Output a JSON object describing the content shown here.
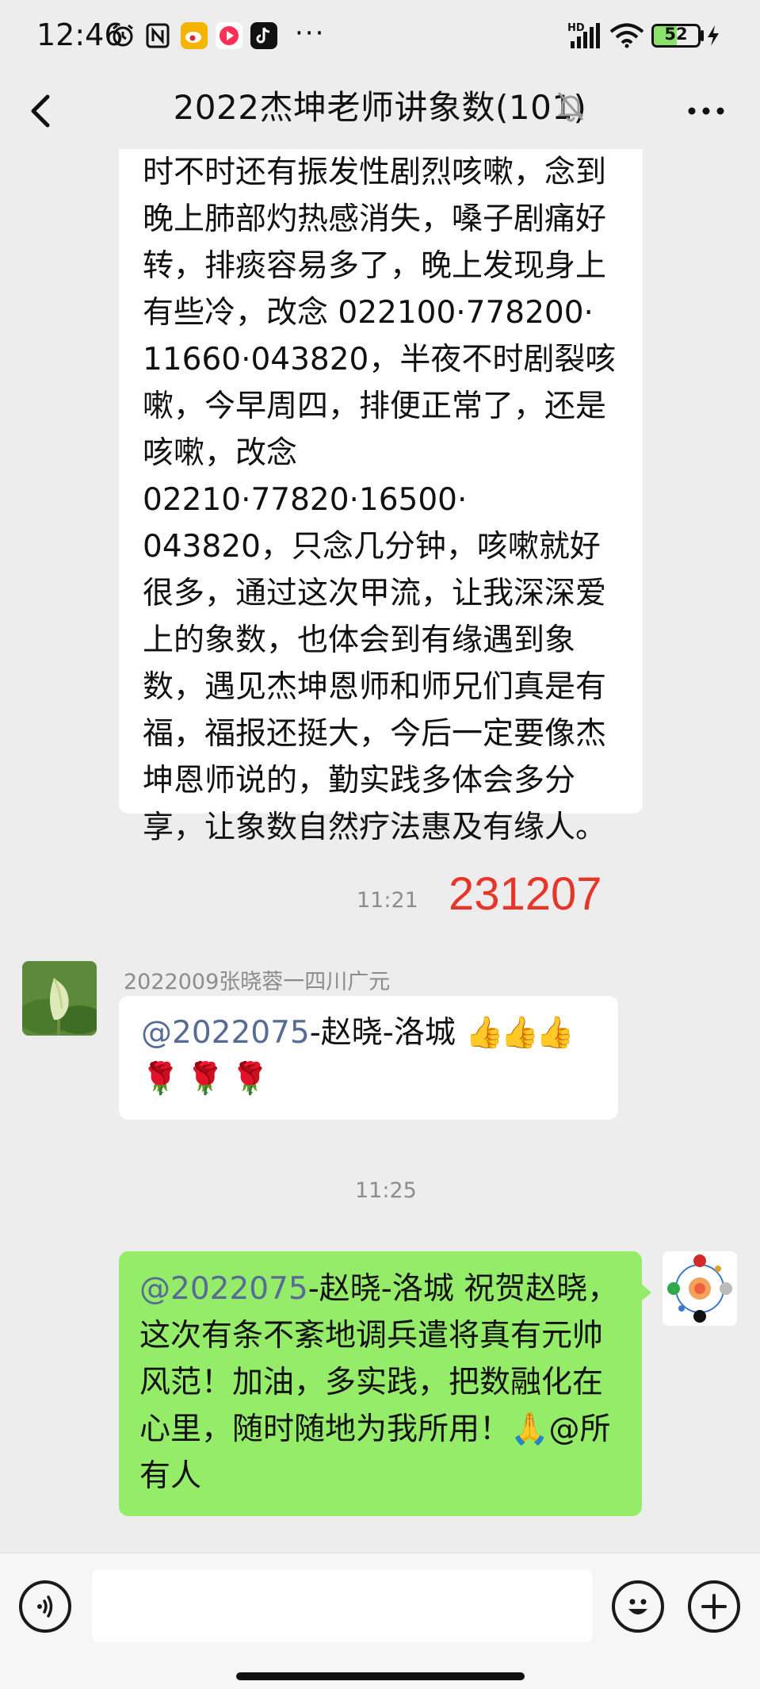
{
  "status_bar": {
    "time": "12:46",
    "battery": "52",
    "network_label": "HD",
    "overflow": "···"
  },
  "header": {
    "title": "2022杰坤老师讲象数(101)"
  },
  "messages": [
    {
      "type": "text",
      "side": "left",
      "lines": [
        "时不时还有振发性剧烈咳嗽，念到",
        "晚上肺部灼热感消失，嗓子剧痛好",
        "转，排痰容易多了，晚上发现身上",
        "有些冷，改念 022100·778200·",
        "11660·043820，半夜不时剧裂咳",
        "嗽，今早周四，排便正常了，还是",
        "咳嗽，改念 02210·77820·16500·",
        "043820，只念几分钟，咳嗽就好",
        "很多，通过这次甲流，让我深深爱",
        "上的象数，也体会到有缘遇到象",
        "数，遇见杰坤恩师和师兄们真是有",
        "福，福报还挺大，今后一定要像杰",
        "坤恩师说的，勤实践多体会多分",
        "享，让象数自然疗法惠及有缘人。"
      ]
    },
    {
      "type": "time",
      "text": "11:21",
      "annotation": "231207"
    },
    {
      "type": "text",
      "side": "left",
      "sender": "2022009张晓蓉一四川广元",
      "mention": "@2022075",
      "mention_rest": "-赵晓-洛城 ",
      "emoji_line1": "👍👍👍",
      "emoji_line2": "🌹🌹🌹"
    },
    {
      "type": "time",
      "text": "11:25"
    },
    {
      "type": "text",
      "side": "right",
      "mention": "@2022075",
      "line1_rest": "-赵晓-洛城  祝贺赵晓，",
      "line2": "这次有条不紊地调兵遣将真有元帅",
      "line3": "风范！加油，多实践，把数融化在",
      "line4": "心里，随时随地为我所用！🙏@所",
      "line5": "有人"
    }
  ],
  "colors": {
    "background": "#ededed",
    "bubble_white": "#ffffff",
    "bubble_green": "#95ec69",
    "mention": "#576b95",
    "annotation_red": "#e8352a"
  },
  "icons": [
    "alarm-icon",
    "nfc-icon",
    "weibo-icon",
    "music-icon",
    "douyin-icon",
    "signal-icon",
    "wifi-icon",
    "battery-icon",
    "charging-icon",
    "back-icon",
    "mute-bell-icon",
    "more-icon",
    "voice-icon",
    "emoji-icon",
    "plus-icon"
  ]
}
